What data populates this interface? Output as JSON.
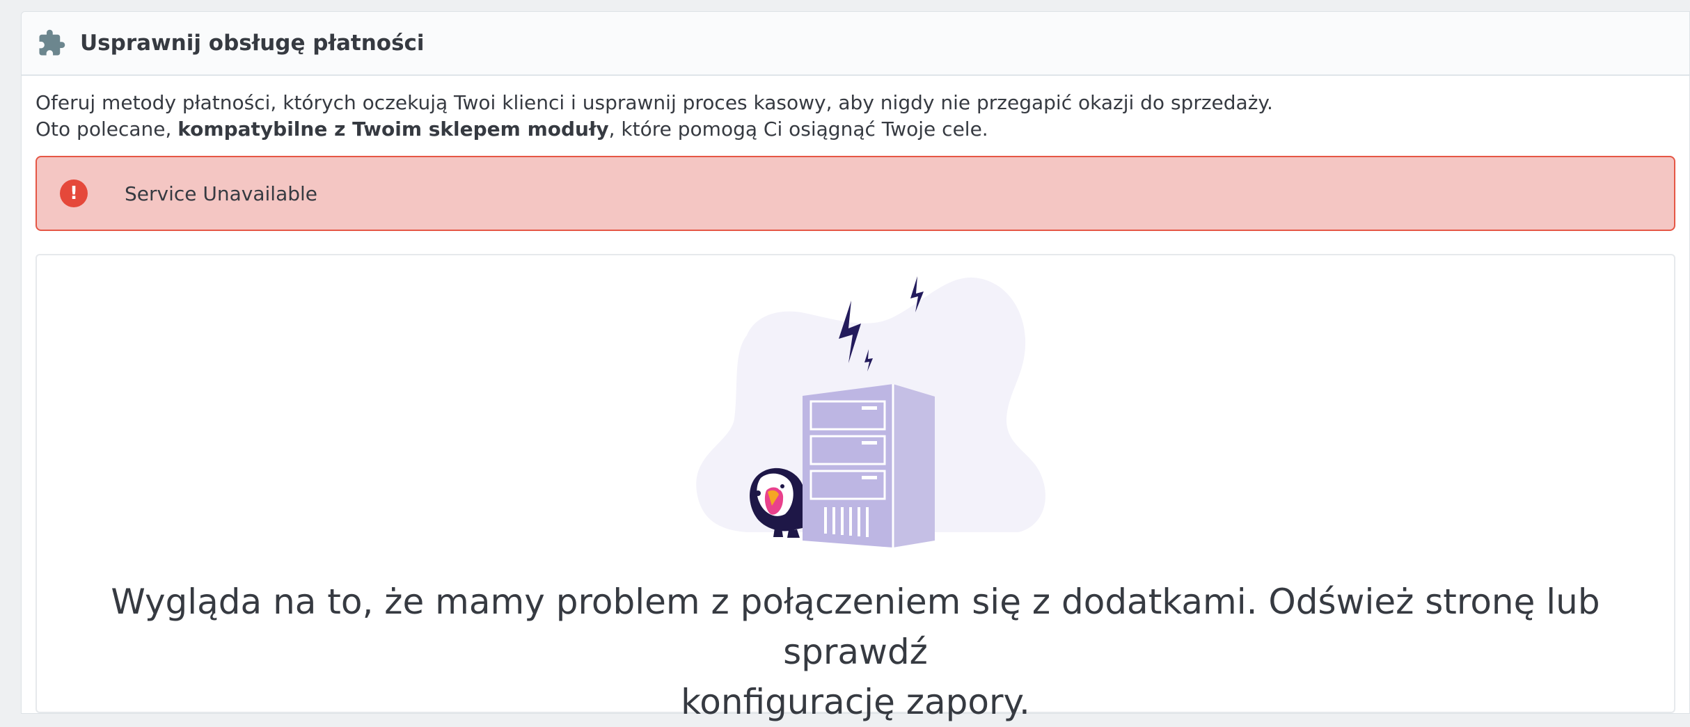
{
  "header": {
    "title": "Usprawnij obsługę płatności",
    "icon": "puzzle-icon"
  },
  "intro": {
    "line1": "Oferuj metody płatności, których oczekują Twoi klienci i usprawnij proces kasowy, aby nigdy nie przegapić okazji do sprzedaży.",
    "line2_prefix": "Oto polecane, ",
    "line2_bold": "kompatybilne z Twoim sklepem moduły",
    "line2_suffix": ", które pomogą Ci osiągnąć Twoje cele."
  },
  "alert": {
    "icon": "exclamation-icon",
    "text": "Service Unavailable",
    "color": "#f4c6c3",
    "border_color": "#e55645"
  },
  "error_panel": {
    "illustration": "server-error-illustration",
    "message_line1": "Wygląda na to, że mamy problem z połączeniem się z dodatkami. Odśwież stronę lub sprawdź",
    "message_line2": "konfigurację zapory."
  }
}
